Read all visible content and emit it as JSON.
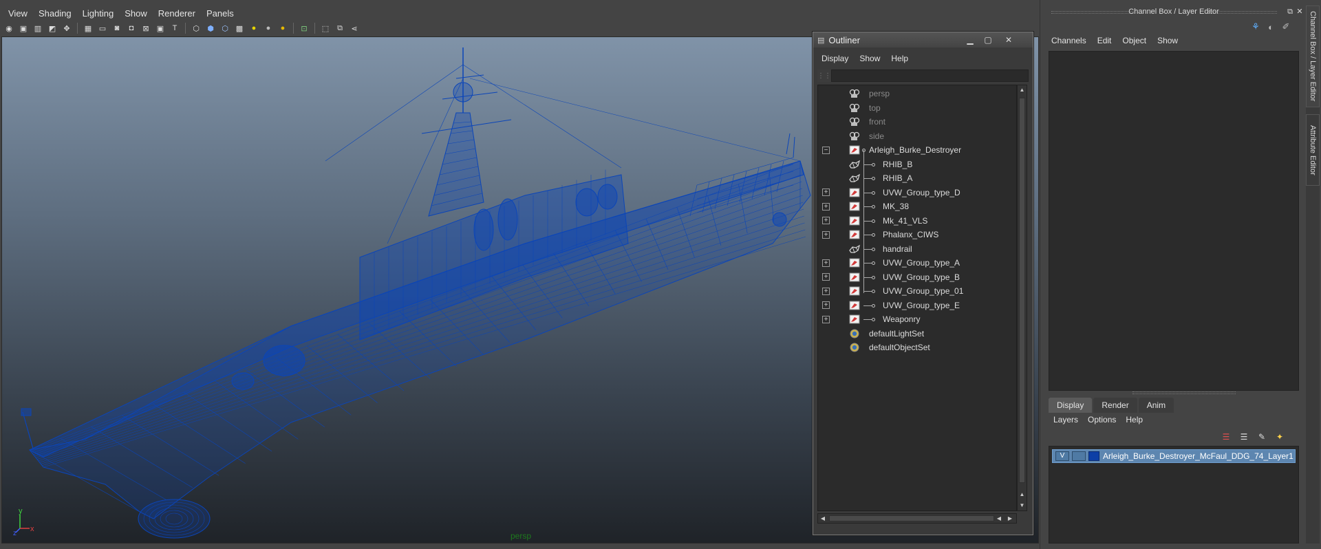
{
  "viewport": {
    "menu": [
      "View",
      "Shading",
      "Lighting",
      "Show",
      "Renderer",
      "Panels"
    ],
    "camera_label": "persp",
    "axis": {
      "x": "x",
      "y": "y",
      "z": "z"
    },
    "wire_color": "#0b45b8"
  },
  "outliner": {
    "title": "Outliner",
    "menu": [
      "Display",
      "Show",
      "Help"
    ],
    "filter_placeholder": "",
    "items": [
      {
        "label": "persp",
        "icon": "camera-icon",
        "dim": true,
        "expander": "",
        "level": 0
      },
      {
        "label": "top",
        "icon": "camera-icon",
        "dim": true,
        "expander": "",
        "level": 0
      },
      {
        "label": "front",
        "icon": "camera-icon",
        "dim": true,
        "expander": "",
        "level": 0
      },
      {
        "label": "side",
        "icon": "camera-icon",
        "dim": true,
        "expander": "",
        "level": 0
      },
      {
        "label": "Arleigh_Burke_Destroyer",
        "icon": "group-icon",
        "dim": false,
        "expander": "−",
        "level": 0
      },
      {
        "label": "RHIB_B",
        "icon": "mesh-icon",
        "dim": false,
        "expander": "",
        "level": 1
      },
      {
        "label": "RHIB_A",
        "icon": "mesh-icon",
        "dim": false,
        "expander": "",
        "level": 1
      },
      {
        "label": "UVW_Group_type_D",
        "icon": "group-icon",
        "dim": false,
        "expander": "+",
        "level": 1
      },
      {
        "label": "MK_38",
        "icon": "group-icon",
        "dim": false,
        "expander": "+",
        "level": 1
      },
      {
        "label": "Mk_41_VLS",
        "icon": "group-icon",
        "dim": false,
        "expander": "+",
        "level": 1
      },
      {
        "label": "Phalanx_CIWS",
        "icon": "group-icon",
        "dim": false,
        "expander": "+",
        "level": 1
      },
      {
        "label": "handrail",
        "icon": "mesh-icon",
        "dim": false,
        "expander": "",
        "level": 1
      },
      {
        "label": "UVW_Group_type_A",
        "icon": "group-icon",
        "dim": false,
        "expander": "+",
        "level": 1
      },
      {
        "label": "UVW_Group_type_B",
        "icon": "group-icon",
        "dim": false,
        "expander": "+",
        "level": 1
      },
      {
        "label": "UVW_Group_type_01",
        "icon": "group-icon",
        "dim": false,
        "expander": "+",
        "level": 1
      },
      {
        "label": "UVW_Group_type_E",
        "icon": "group-icon",
        "dim": false,
        "expander": "+",
        "level": 1
      },
      {
        "label": "Weaponry",
        "icon": "group-icon",
        "dim": false,
        "expander": "+",
        "level": 1
      },
      {
        "label": "defaultLightSet",
        "icon": "set-icon",
        "dim": false,
        "expander": "",
        "level": 0
      },
      {
        "label": "defaultObjectSet",
        "icon": "set-icon",
        "dim": false,
        "expander": "",
        "level": 0
      }
    ]
  },
  "channel_box": {
    "title": "Channel Box / Layer Editor",
    "menu": [
      "Channels",
      "Edit",
      "Object",
      "Show"
    ],
    "layer_tabs": [
      "Display",
      "Render",
      "Anim"
    ],
    "layer_menu": [
      "Layers",
      "Options",
      "Help"
    ],
    "layer": {
      "visible": "V",
      "name": "Arleigh_Burke_Destroyer_McFaul_DDG_74_Layer1",
      "color": "#0d3fa6"
    }
  },
  "side_tabs": [
    "Channel Box / Layer Editor",
    "Attribute Editor"
  ]
}
